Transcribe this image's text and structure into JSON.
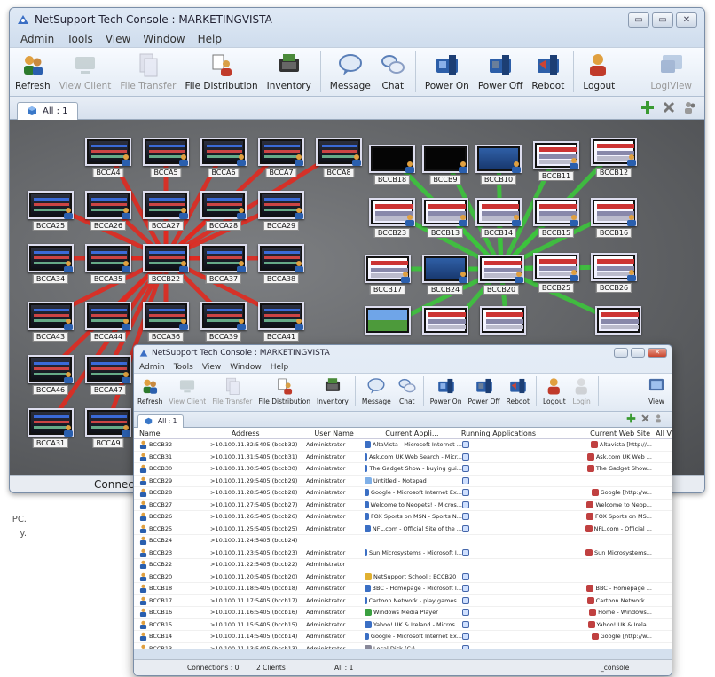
{
  "side_text": [
    "PC.",
    "y."
  ],
  "back_window": {
    "title": "NetSupport Tech Console : MARKETINGVISTA",
    "window_buttons": [
      "▭",
      "▭",
      "✕"
    ],
    "menu": [
      "Admin",
      "Tools",
      "View",
      "Window",
      "Help"
    ],
    "toolbar": [
      {
        "label": "Refresh",
        "icon": "refresh-icon",
        "enabled": true
      },
      {
        "label": "View Client",
        "icon": "view-client-icon",
        "enabled": false
      },
      {
        "label": "File Transfer",
        "icon": "file-transfer-icon",
        "enabled": false
      },
      {
        "label": "File Distribution",
        "icon": "file-distribution-icon",
        "enabled": true
      },
      {
        "label": "Inventory",
        "icon": "inventory-icon",
        "enabled": true
      },
      {
        "label": "Message",
        "icon": "message-icon",
        "enabled": true
      },
      {
        "label": "Chat",
        "icon": "chat-icon",
        "enabled": true
      },
      {
        "label": "Power On",
        "icon": "power-on-icon",
        "enabled": true
      },
      {
        "label": "Power Off",
        "icon": "power-off-icon",
        "enabled": true
      },
      {
        "label": "Reboot",
        "icon": "reboot-icon",
        "enabled": true
      },
      {
        "label": "Logout",
        "icon": "logout-icon",
        "enabled": true
      },
      {
        "label": "LogiView",
        "icon": "logiview-icon",
        "enabled": false
      }
    ],
    "tab_label": "All : 1",
    "status": "Connec",
    "red_cluster": {
      "center": "BCCB22",
      "nodes": [
        "BCCA4",
        "BCCA5",
        "BCCA6",
        "BCCA7",
        "BCCA8",
        "BCCA25",
        "BCCA26",
        "BCCA27",
        "BCCA28",
        "BCCA29",
        "BCCA34",
        "BCCA35",
        "BCCA37",
        "BCCA38",
        "BCCA43",
        "BCCA44",
        "BCCA36",
        "BCCA39",
        "BCCA41",
        "BCCA46",
        "BCCA47",
        "BCCA31",
        "BCCA9"
      ]
    },
    "green_cluster": {
      "center": "BCCB20",
      "nodes": [
        "BCCB18",
        "BCCB9",
        "BCCB10",
        "BCCB11",
        "BCCB12",
        "BCCB23",
        "BCCB13",
        "BCCB14",
        "BCCB15",
        "BCCB16",
        "BCCB17",
        "BCCB24",
        "BCCB25",
        "BCCB26"
      ]
    }
  },
  "front_window": {
    "title": "NetSupport Tech Console : MARKETINGVISTA",
    "menu": [
      "Admin",
      "Tools",
      "View",
      "Window",
      "Help"
    ],
    "toolbar": [
      {
        "label": "Refresh",
        "icon": "refresh-icon",
        "enabled": true
      },
      {
        "label": "View Client",
        "icon": "view-client-icon",
        "enabled": false
      },
      {
        "label": "File Transfer",
        "icon": "file-transfer-icon",
        "enabled": false
      },
      {
        "label": "File Distribution",
        "icon": "file-distribution-icon",
        "enabled": true
      },
      {
        "label": "Inventory",
        "icon": "inventory-icon",
        "enabled": true
      },
      {
        "label": "Message",
        "icon": "message-icon",
        "enabled": true
      },
      {
        "label": "Chat",
        "icon": "chat-icon",
        "enabled": true
      },
      {
        "label": "Power On",
        "icon": "power-on-icon",
        "enabled": true
      },
      {
        "label": "Power Off",
        "icon": "power-off-icon",
        "enabled": true
      },
      {
        "label": "Reboot",
        "icon": "reboot-icon",
        "enabled": true
      },
      {
        "label": "Logout",
        "icon": "logout-icon",
        "enabled": true
      },
      {
        "label": "Login",
        "icon": "login-icon",
        "enabled": false
      },
      {
        "label": "View",
        "icon": "view-icon",
        "enabled": true
      }
    ],
    "tab_label": "All : 1",
    "columns": [
      "Name",
      "Address",
      "User Name",
      "Current Appli...",
      "Running Applications",
      "Current Web Site",
      "All V"
    ],
    "rows": [
      {
        "name": "BCCB32",
        "address": ">10.100.11.32:5405 (bccb32)",
        "user": "Administrator",
        "app": "AltaVista - Microsoft Internet ...",
        "web": "Altavista [http://..."
      },
      {
        "name": "BCCB31",
        "address": ">10.100.11.31:5405 (bccb31)",
        "user": "Administrator",
        "app": "Ask.com UK Web Search - Micr...",
        "web": "Ask.com UK Web ..."
      },
      {
        "name": "BCCB30",
        "address": ">10.100.11.30:5405 (bccb30)",
        "user": "Administrator",
        "app": "The Gadget Show - buying gui...",
        "web": "The Gadget Show..."
      },
      {
        "name": "BCCB29",
        "address": ">10.100.11.29:5405 (bccb29)",
        "user": "Administrator",
        "app": "Untitled - Notepad",
        "web": ""
      },
      {
        "name": "BCCB28",
        "address": ">10.100.11.28:5405 (bccb28)",
        "user": "Administrator",
        "app": "Google - Microsoft Internet Ex...",
        "web": "Google [http://w..."
      },
      {
        "name": "BCCB27",
        "address": ">10.100.11.27:5405 (bccb27)",
        "user": "Administrator",
        "app": "Welcome to Neopets! - Micros...",
        "web": "Welcome to Neop..."
      },
      {
        "name": "BCCB26",
        "address": ">10.100.11.26:5405 (bccb26)",
        "user": "Administrator",
        "app": "FOX Sports on MSN - Sports N...",
        "web": "FOX Sports on MS..."
      },
      {
        "name": "BCCB25",
        "address": ">10.100.11.25:5405 (bccb25)",
        "user": "Administrator",
        "app": "NFL.com - Official Site of the ...",
        "web": "NFL.com - Official ..."
      },
      {
        "name": "BCCB24",
        "address": ">10.100.11.24:5405 (bccb24)",
        "user": "",
        "app": "",
        "web": ""
      },
      {
        "name": "BCCB23",
        "address": ">10.100.11.23:5405 (bccb23)",
        "user": "Administrator",
        "app": "Sun Microsystems - Microsoft I...",
        "web": "Sun Microsystems..."
      },
      {
        "name": "BCCB22",
        "address": ">10.100.11.22:5405 (bccb22)",
        "user": "Administrator",
        "app": "",
        "web": ""
      },
      {
        "name": "BCCB20",
        "address": ">10.100.11.20:5405 (bccb20)",
        "user": "Administrator",
        "app": "NetSupport School : BCCB20",
        "web": ""
      },
      {
        "name": "BCCB18",
        "address": ">10.100.11.18:5405 (bccb18)",
        "user": "Administrator",
        "app": "BBC - Homepage - Microsoft I...",
        "web": "BBC - Homepage ..."
      },
      {
        "name": "BCCB17",
        "address": ">10.100.11.17:5405 (bccb17)",
        "user": "Administrator",
        "app": "Cartoon Network - play games...",
        "web": "Cartoon Network ..."
      },
      {
        "name": "BCCB16",
        "address": ">10.100.11.16:5405 (bccb16)",
        "user": "Administrator",
        "app": "Windows Media Player",
        "web": "Home - Windows..."
      },
      {
        "name": "BCCB15",
        "address": ">10.100.11.15:5405 (bccb15)",
        "user": "Administrator",
        "app": "Yahoo! UK & Ireland - Micros...",
        "web": "Yahoo! UK & Irela..."
      },
      {
        "name": "BCCB14",
        "address": ">10.100.11.14:5405 (bccb14)",
        "user": "Administrator",
        "app": "Google - Microsoft Internet Ex...",
        "web": "Google [http://w..."
      },
      {
        "name": "BCCB13",
        "address": ">10.100.11.13:5405 (bccb13)",
        "user": "Administrator",
        "app": "Local Disk (C:)",
        "web": ""
      },
      {
        "name": "BCCB12",
        "address": ">10.100.11.12:5405 (bccb12)",
        "user": "Administrator",
        "app": "News, Sport, Music, Movies ...",
        "web": "News, Sport, Mus..."
      }
    ],
    "status": {
      "connections": "Connections : 0",
      "clients": "2 Clients",
      "all": "All : 1",
      "console": "_console"
    }
  }
}
